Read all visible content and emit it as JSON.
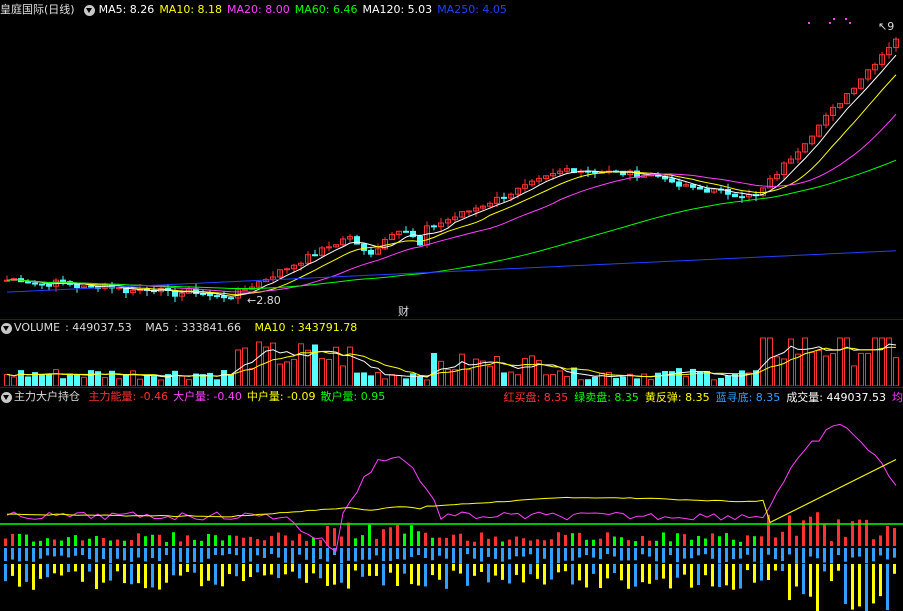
{
  "main": {
    "stock_name": "皇庭国际(日线)",
    "ma": [
      {
        "label": "MA5",
        "value": "8.26",
        "color": "#ffffff"
      },
      {
        "label": "MA10",
        "value": "8.18",
        "color": "#ffff00"
      },
      {
        "label": "MA20",
        "value": "8.00",
        "color": "#ff40ff"
      },
      {
        "label": "MA60",
        "value": "6.46",
        "color": "#00ff00"
      },
      {
        "label": "MA120",
        "value": "5.03",
        "color": "#ffffff"
      },
      {
        "label": "MA250",
        "value": "4.05",
        "color": "#2040ff"
      }
    ],
    "low_marker": "2.80",
    "high_marker": "9",
    "fin_marker": "财"
  },
  "volume": {
    "title": "VOLUME",
    "value": "449037.53",
    "ma5_label": "MA5",
    "ma5": "333841.66",
    "ma10_label": "MA10",
    "ma10": "343791.78"
  },
  "indicator": {
    "name": "主力大户持仓",
    "items": [
      {
        "label": "主力能量",
        "value": "-0.46",
        "color": "#ff3030"
      },
      {
        "label": "大户量",
        "value": "-0.40",
        "color": "#ff40ff"
      },
      {
        "label": "中户量",
        "value": "-0.09",
        "color": "#ffff00"
      },
      {
        "label": "散户量",
        "value": "0.95",
        "color": "#00ff00"
      }
    ],
    "right_items": [
      {
        "label": "红买盘",
        "value": "8.35",
        "color": "#ff3030"
      },
      {
        "label": "绿卖盘",
        "value": "8.35",
        "color": "#00ff00"
      },
      {
        "label": "黄反弹",
        "value": "8.35",
        "color": "#ffff00"
      },
      {
        "label": "蓝寻底",
        "value": "8.35",
        "color": "#30a0ff"
      },
      {
        "label": "成交量",
        "value": "449037.53",
        "color": "#ffffff"
      },
      {
        "label": "均",
        "value": "",
        "color": "#ff40ff"
      }
    ]
  },
  "colors": {
    "up": "#ff3232",
    "down": "#54ffff",
    "bg": "#000000",
    "separator": "#7a0000"
  }
}
